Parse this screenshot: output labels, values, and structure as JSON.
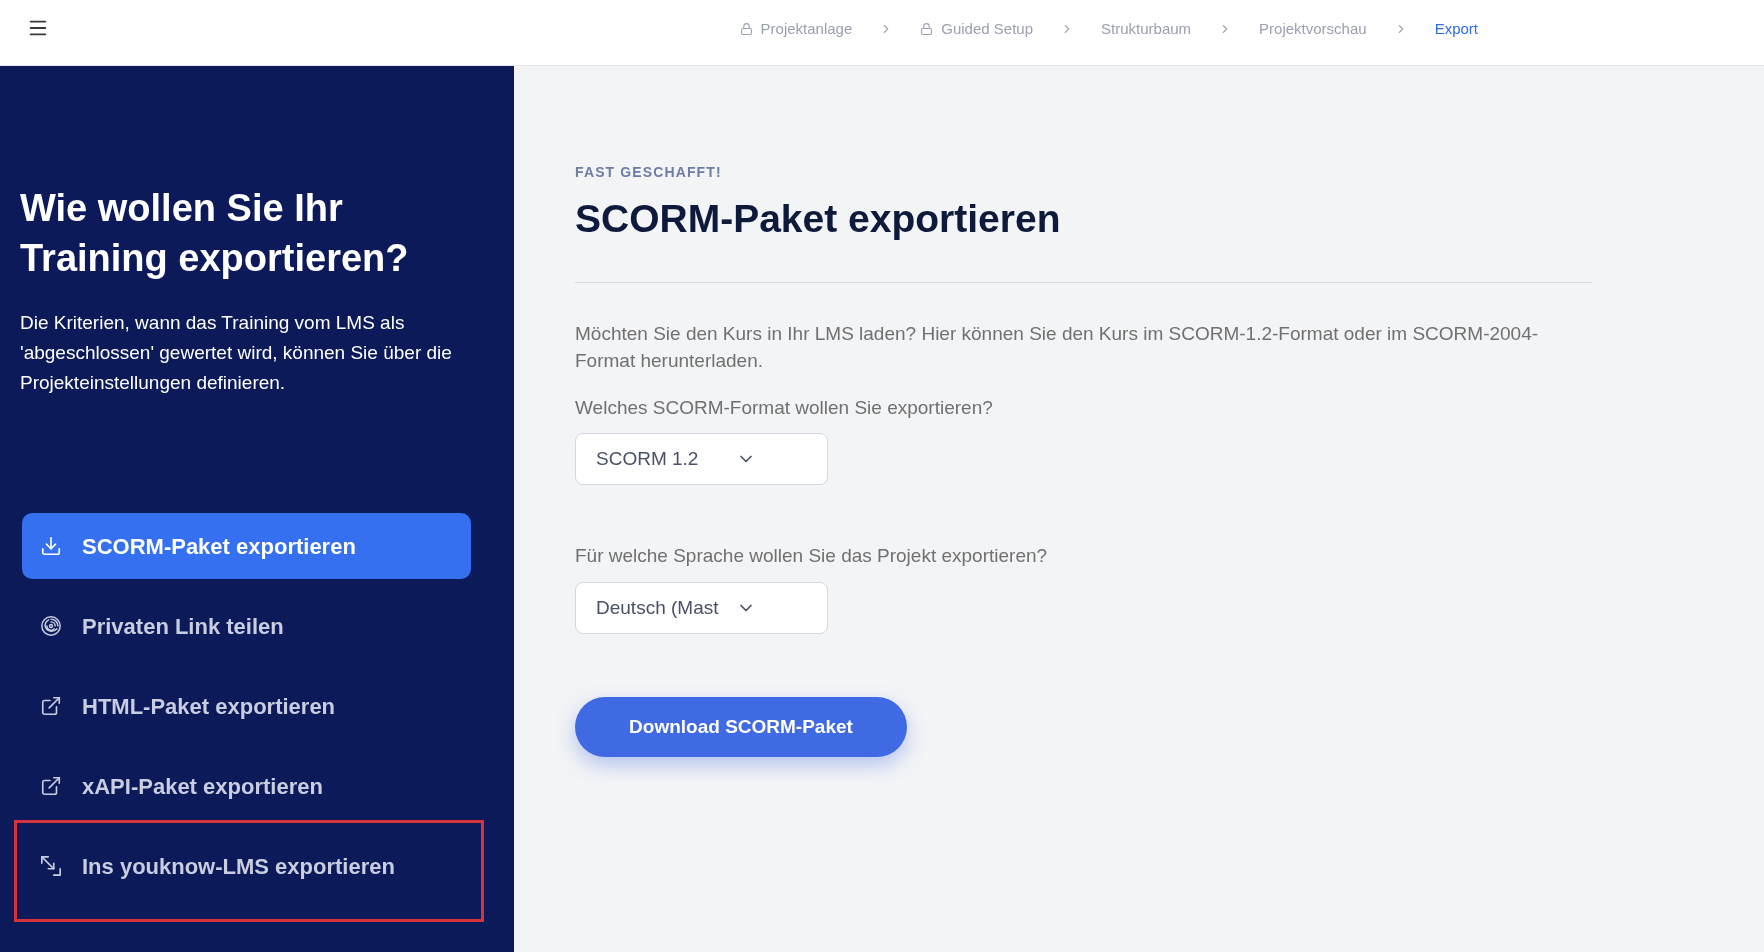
{
  "header": {
    "breadcrumb": [
      {
        "label": "Projektanlage",
        "locked": true,
        "selected": false
      },
      {
        "label": "Guided Setup",
        "locked": true,
        "selected": false
      },
      {
        "label": "Strukturbaum",
        "locked": false,
        "selected": false
      },
      {
        "label": "Projektvorschau",
        "locked": false,
        "selected": false
      },
      {
        "label": "Export",
        "locked": false,
        "selected": true
      }
    ]
  },
  "sidebar": {
    "title": "Wie wollen Sie Ihr Training exportieren?",
    "description": "Die Kriterien, wann das Training vom LMS als 'abgeschlossen' gewertet wird, können Sie über die Projekteinstellungen definieren.",
    "items": [
      {
        "kind": "download",
        "label": "SCORM-Paket exportieren",
        "selected": true,
        "highlighted": false
      },
      {
        "kind": "private_link",
        "label": "Privaten Link teilen",
        "selected": false,
        "highlighted": false
      },
      {
        "kind": "external",
        "label": "HTML-Paket exportieren",
        "selected": false,
        "highlighted": false
      },
      {
        "kind": "external",
        "label": "xAPI-Paket exportieren",
        "selected": false,
        "highlighted": false
      },
      {
        "kind": "transfer",
        "label": "Ins youknow-LMS exportieren",
        "selected": false,
        "highlighted": true
      }
    ]
  },
  "main": {
    "eyebrow": "FAST GESCHAFFT!",
    "title": "SCORM-Paket exportieren",
    "intro": "Möchten Sie den Kurs in Ihr LMS laden? Hier können Sie den Kurs im SCORM-1.2-Format oder im SCORM-2004-Format herunterladen.",
    "fields": [
      {
        "label": "Welches SCORM-Format wollen Sie exportieren?",
        "value": "SCORM 1.2"
      },
      {
        "label": "Für welche Sprache wollen Sie das Projekt exportieren?",
        "value": "Deutsch (Mast"
      }
    ],
    "button": "Download SCORM-Paket"
  }
}
